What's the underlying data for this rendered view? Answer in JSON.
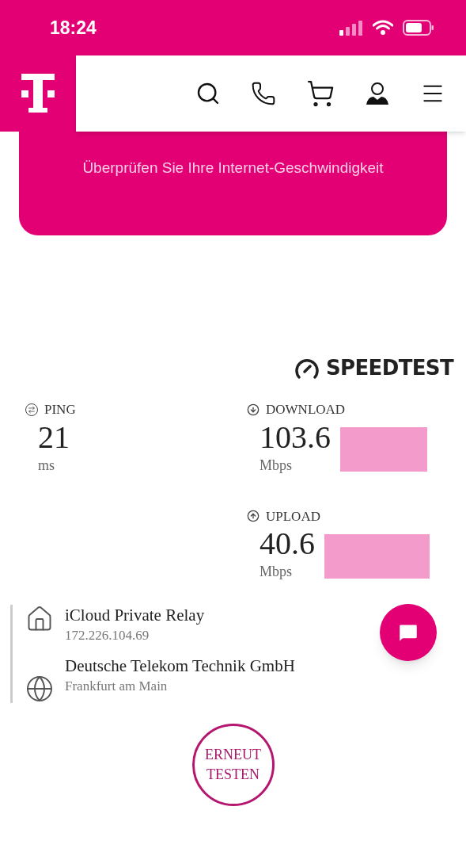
{
  "status_bar": {
    "time": "18:24"
  },
  "hero": {
    "subtitle": "Überprüfen Sie Ihre Internet-Geschwindigkeit"
  },
  "speedtest_logo": {
    "label": "SPEEDTEST"
  },
  "metrics": [
    {
      "kind": "ping",
      "label": "PING",
      "value": "21",
      "unit": "ms"
    },
    {
      "kind": "download",
      "label": "DOWNLOAD",
      "value": "103.6",
      "unit": "Mbps"
    },
    {
      "kind": "upload",
      "label": "UPLOAD",
      "value": "40.6",
      "unit": "Mbps"
    }
  ],
  "connection": [
    {
      "kind": "home",
      "title": "iCloud Private Relay",
      "detail": "172.226.104.69"
    },
    {
      "kind": "globe",
      "title": "Deutsche Telekom Technik GmbH",
      "detail": "Frankfurt am Main"
    }
  ],
  "retest_button": {
    "line_1": "ERNEUT",
    "line_2": "TESTEN"
  }
}
